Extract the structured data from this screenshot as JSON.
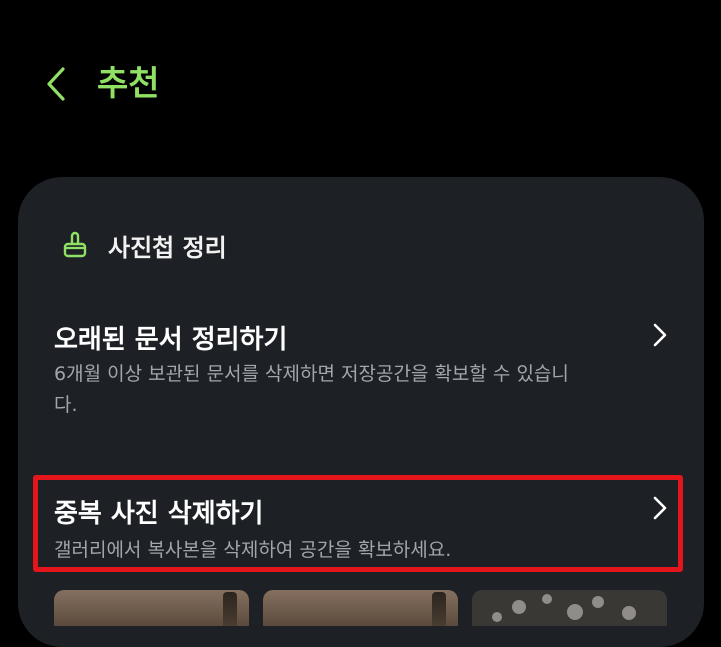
{
  "header": {
    "title": "추천",
    "back_icon": "chevron-left-icon",
    "accent_color": "#8fe063"
  },
  "card": {
    "section": {
      "title": "사진첩 정리",
      "icon": "brush-icon"
    },
    "items": [
      {
        "title": "오래된 문서 정리하기",
        "description": "6개월 이상 보관된 문서를 삭제하면 저장공간을 확보할 수 있습니다.",
        "icon": "chevron-right-icon"
      },
      {
        "title": "중복 사진 삭제하기",
        "description": "갤러리에서 복사본을 삭제하여 공간을 확보하세요.",
        "icon": "chevron-right-icon",
        "highlighted": true
      }
    ],
    "thumbnails": [
      "photo-thumbnail",
      "photo-thumbnail",
      "photo-thumbnail"
    ]
  },
  "colors": {
    "background": "#000000",
    "card": "#1d2024",
    "highlight": "#e4161b",
    "secondary_text": "#a2a6ab"
  }
}
